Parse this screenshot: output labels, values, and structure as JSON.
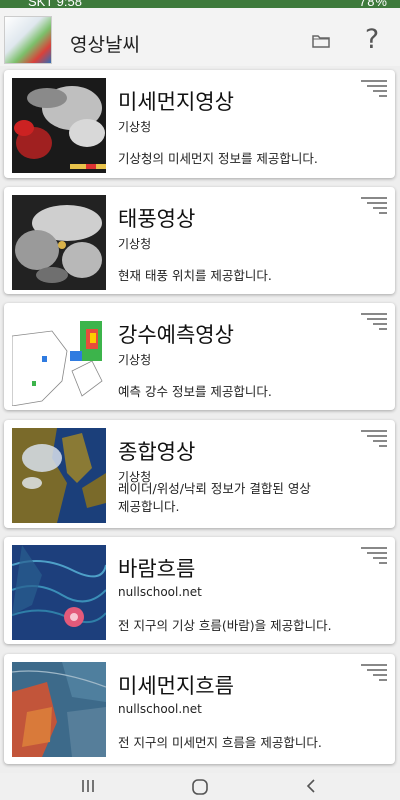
{
  "status": {
    "time": "SKT 9:58",
    "right": "78%"
  },
  "app": {
    "title": "영상날씨"
  },
  "cards": [
    {
      "title": "미세먼지영상",
      "source": "기상청",
      "desc": "기상청의 미세먼지 정보를 제공합니다."
    },
    {
      "title": "태풍영상",
      "source": "기상청",
      "desc": "현재 태풍 위치를 제공합니다."
    },
    {
      "title": "강수예측영상",
      "source": "기상청",
      "desc": "예측 강수 정보를 제공합니다."
    },
    {
      "title": "종합영상",
      "source": "기상청",
      "desc_line1": "레이더/위성/낙뢰 정보가 결합된 영상",
      "desc_line2": "제공합니다."
    },
    {
      "title": "바람흐름",
      "source": "nullschool.net",
      "desc": "전 지구의 기상 흐름(바람)을 제공합니다."
    },
    {
      "title": "미세먼지흐름",
      "source": "nullschool.net",
      "desc": "전 지구의 미세먼지 흐름을 제공합니다."
    }
  ],
  "icons": {
    "folder": "folder-icon",
    "help": "help-icon",
    "menu": "menu-icon",
    "nav_recents": "recent-apps-icon",
    "nav_home": "home-icon",
    "nav_back": "back-icon"
  },
  "colors": {
    "status_bar": "#3e7a3c",
    "card_bg": "#ffffff",
    "page_bg": "#eeeeee"
  }
}
